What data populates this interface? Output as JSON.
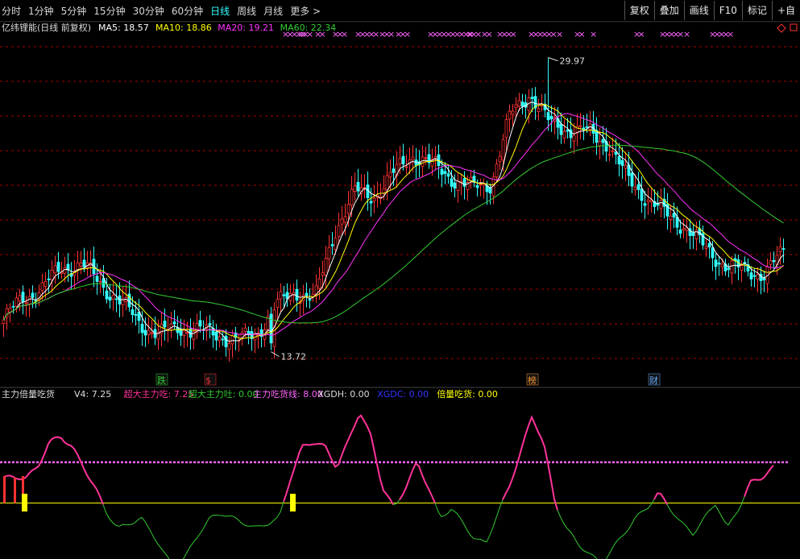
{
  "toolbar": {
    "periods": [
      "分时",
      "1分钟",
      "5分钟",
      "15分钟",
      "30分钟",
      "60分钟",
      "日线",
      "周线",
      "月线",
      "更多 >"
    ],
    "active_period": "日线",
    "tools": [
      "复权",
      "叠加",
      "画线",
      "F10",
      "标记",
      "+自"
    ]
  },
  "colors": {
    "background": "#000000",
    "up": "#ff3333",
    "down": "#33ffff",
    "ma5": "#ffffff",
    "ma10": "#ffff00",
    "ma20": "#ff33ff",
    "ma60": "#33cc33",
    "grid": "#aa0000",
    "pink": "#ff3399",
    "green": "#33cc33",
    "yellow": "#ffff00",
    "magenta": "#ff66ff",
    "blue": "#3333ff"
  },
  "main_legend": {
    "title": "亿纬锂能(日线 前复权)",
    "items": [
      {
        "label": "MA5: 18.57",
        "color": "#ffffff"
      },
      {
        "label": "MA10: 18.86",
        "color": "#ffff00"
      },
      {
        "label": "MA20: 19.21",
        "color": "#ff33ff"
      },
      {
        "label": "MA60: 22.34",
        "color": "#33cc33"
      }
    ]
  },
  "markers": {
    "high_label": "29.97",
    "low_label": "13.72",
    "events": [
      {
        "text": "跌",
        "color": "#33cc33"
      },
      {
        "text": "$",
        "color": "#ff3333"
      },
      {
        "text": "榜",
        "color": "#ff9933"
      },
      {
        "text": "财",
        "color": "#66aaff"
      }
    ]
  },
  "indicator_legend": {
    "title": "主力倍量吃货",
    "items": [
      {
        "label": "V4: 7.25",
        "color": "#dddddd"
      },
      {
        "label": "超大主力吃: 7.25",
        "color": "#ff3399"
      },
      {
        "label": "超大主力吐: 0.00",
        "color": "#33cc33"
      },
      {
        "label": "主力吃货线: 8.00",
        "color": "#ff66ff"
      },
      {
        "label": "XGDH: 0.00",
        "color": "#dddddd"
      },
      {
        "label": "XGDC: 0.00",
        "color": "#3333ff"
      },
      {
        "label": "倍量吃货: 0.00",
        "color": "#ffff00"
      }
    ]
  },
  "chart_data": {
    "type": "candlestick",
    "title": "亿纬锂能(日线 前复权)",
    "y_high": 29.97,
    "y_low": 13.72,
    "ylim": [
      12.5,
      31.2
    ],
    "ma_last": {
      "MA5": 18.57,
      "MA10": 18.86,
      "MA20": 19.21,
      "MA60": 22.34
    },
    "key_closes": [
      15.4,
      16.6,
      17.2,
      18.3,
      18.5,
      17.4,
      16.4,
      15.2,
      14.6,
      15.0,
      14.8,
      14.6,
      14.2,
      14.7,
      16.2,
      17.0,
      16.6,
      20.4,
      22.5,
      22.3,
      23.5,
      24.6,
      24.0,
      23.3,
      22.7,
      23.0,
      26.8,
      28.0,
      26.3,
      26.0,
      25.8,
      25.2,
      23.2,
      22.2,
      21.2,
      20.6,
      19.3,
      18.5,
      18.1,
      18.0,
      19.1
    ],
    "indicator": {
      "name": "主力倍量吃货",
      "ylim": [
        -11,
        20
      ],
      "main_line": 8.0,
      "baseline": 0,
      "key_values": [
        5,
        5,
        5,
        7,
        12,
        13,
        11,
        7,
        3,
        -2,
        -5,
        -4,
        -3,
        -6,
        -10,
        -13,
        -10,
        -6,
        -3,
        -2,
        -3,
        -4,
        -5,
        -4,
        -3,
        5,
        11,
        12,
        11,
        7,
        12,
        18,
        13,
        3,
        -1,
        3,
        8,
        3,
        -3,
        -1,
        -4,
        -7,
        -8,
        -2,
        3,
        10,
        17,
        12,
        0,
        -5,
        -8,
        -10,
        -12,
        -9,
        -6,
        -3,
        -1,
        2,
        -1,
        -4,
        -6,
        -3,
        0,
        -5,
        -1,
        4,
        5,
        7
      ]
    }
  }
}
